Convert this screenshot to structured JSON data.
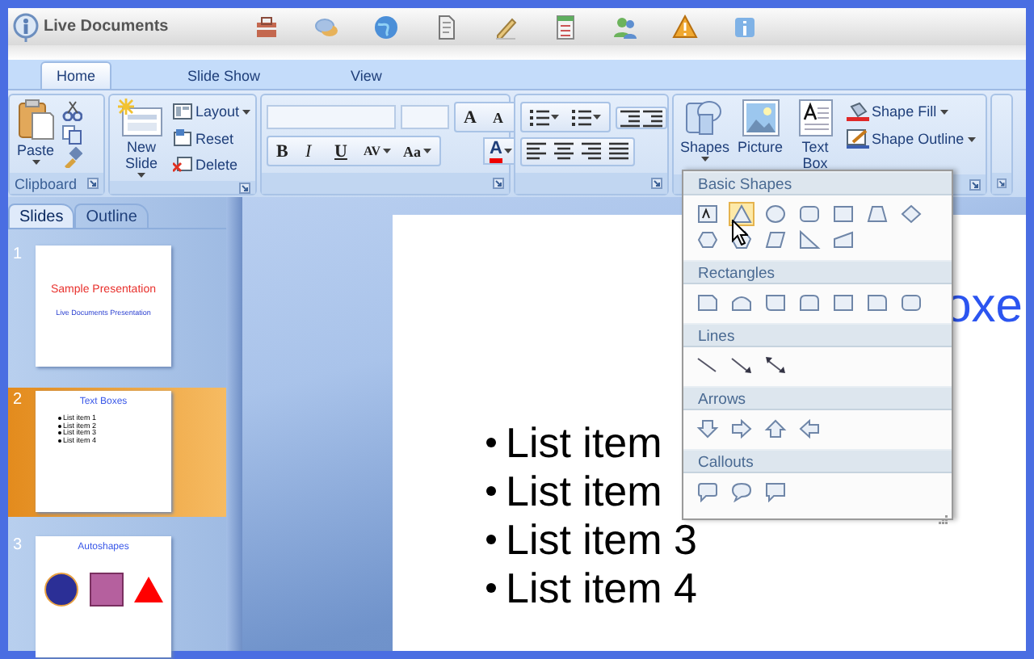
{
  "app": {
    "title": "Live Documents"
  },
  "tabs": [
    {
      "label": "Home",
      "selected": true
    },
    {
      "label": "Slide Show",
      "selected": false
    },
    {
      "label": "View",
      "selected": false
    }
  ],
  "ribbon": {
    "clipboard": {
      "label": "Clipboard",
      "paste": "Paste"
    },
    "slides": {
      "new_slide": "New Slide",
      "layout": "Layout",
      "reset": "Reset",
      "delete": "Delete"
    },
    "font": {
      "grow": "A",
      "shrink": "A",
      "bold": "B",
      "italic": "I",
      "underline": "U",
      "spacing": "AV",
      "change_case": "Aa",
      "font_color": "A"
    },
    "drawing": {
      "shapes": "Shapes",
      "picture": "Picture",
      "text_box": "Text Box",
      "shape_fill": "Shape Fill",
      "shape_outline": "Shape Outline"
    }
  },
  "panel_tabs": [
    {
      "label": "Slides",
      "selected": true
    },
    {
      "label": "Outline",
      "selected": false
    }
  ],
  "thumbnails": [
    {
      "number": "1",
      "selected": false,
      "kind": "title",
      "title": "Sample Presentation",
      "subtitle": "Live Documents Presentation"
    },
    {
      "number": "2",
      "selected": true,
      "kind": "list",
      "title": "Text Boxes",
      "items": [
        "List item 1",
        "List item 2",
        "List item 3",
        "List item 4"
      ]
    },
    {
      "number": "3",
      "selected": false,
      "kind": "shapes",
      "title": "Autoshapes"
    }
  ],
  "slide": {
    "title": "oxe",
    "items": [
      "List item",
      "List item",
      "List item 3",
      "List item 4"
    ]
  },
  "shapes_menu": [
    {
      "title": "Basic Shapes",
      "shapes": [
        {
          "kind": "text-box",
          "selected": false
        },
        {
          "kind": "triangle",
          "selected": true
        },
        {
          "kind": "oval",
          "selected": false
        },
        {
          "kind": "rounded-rectangle",
          "selected": false
        },
        {
          "kind": "rectangle",
          "selected": false
        },
        {
          "kind": "trapezoid",
          "selected": false
        },
        {
          "kind": "diamond",
          "selected": false
        },
        {
          "kind": "hexagon",
          "selected": false
        },
        {
          "kind": "pentagon",
          "selected": false
        },
        {
          "kind": "parallelogram",
          "selected": false
        },
        {
          "kind": "right-triangle",
          "selected": false
        },
        {
          "kind": "slanted-rectangle",
          "selected": false
        }
      ]
    },
    {
      "title": "Rectangles",
      "shapes": [
        {
          "kind": "snipped-rectangle",
          "selected": false
        },
        {
          "kind": "arched-rectangle",
          "selected": false
        },
        {
          "kind": "curved-rectangle",
          "selected": false
        },
        {
          "kind": "rounded-top-rectangle",
          "selected": false
        },
        {
          "kind": "rectangle",
          "selected": false
        },
        {
          "kind": "rounded-corner-rectangle",
          "selected": false
        },
        {
          "kind": "rounded-rectangle",
          "selected": false
        }
      ]
    },
    {
      "title": "Lines",
      "shapes": [
        {
          "kind": "line",
          "selected": false
        },
        {
          "kind": "arrow-line",
          "selected": false
        },
        {
          "kind": "double-arrow-line",
          "selected": false
        }
      ]
    },
    {
      "title": "Arrows",
      "shapes": [
        {
          "kind": "down-arrow",
          "selected": false
        },
        {
          "kind": "right-arrow",
          "selected": false
        },
        {
          "kind": "up-arrow",
          "selected": false
        },
        {
          "kind": "left-arrow",
          "selected": false
        }
      ]
    },
    {
      "title": "Callouts",
      "shapes": [
        {
          "kind": "rounded-callout",
          "selected": false
        },
        {
          "kind": "oval-callout",
          "selected": false
        },
        {
          "kind": "rectangle-callout",
          "selected": false
        }
      ]
    }
  ]
}
